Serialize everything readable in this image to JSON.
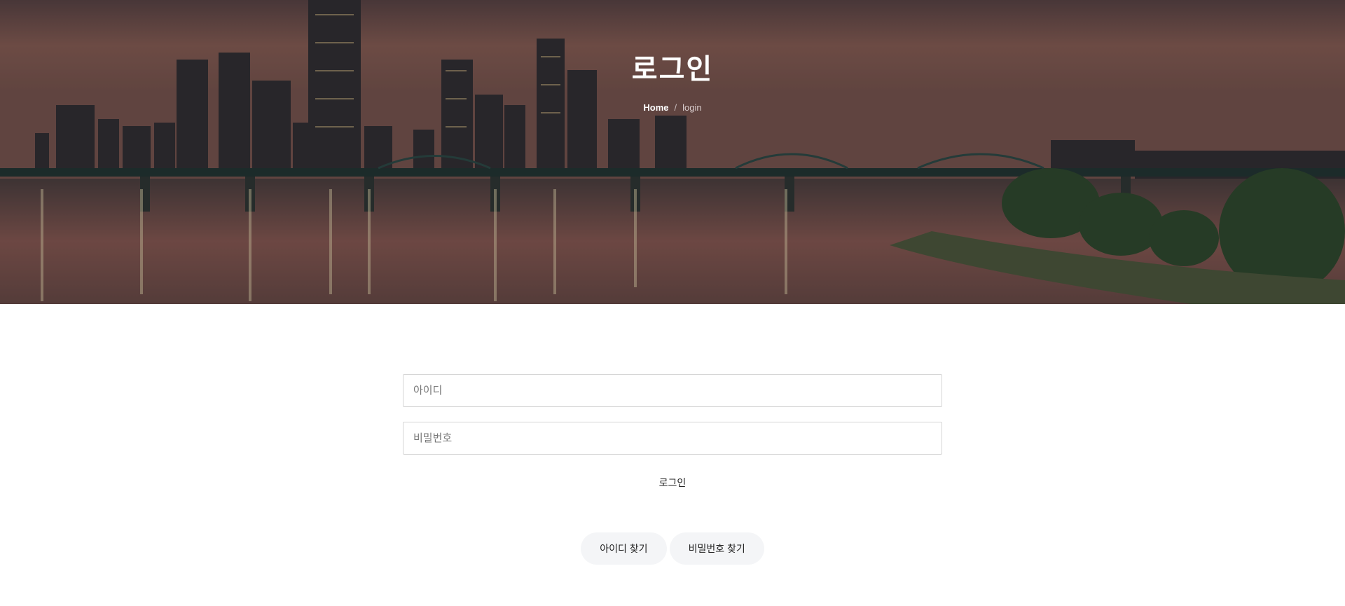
{
  "hero": {
    "title": "로그인",
    "breadcrumb": {
      "home": "Home",
      "separator": "/",
      "current": "login"
    }
  },
  "form": {
    "username_placeholder": "아이디",
    "password_placeholder": "비밀번호",
    "username_value": "",
    "password_value": "",
    "submit_label": "로그인"
  },
  "links": {
    "find_id_label": "아이디 찾기",
    "find_password_label": "비밀번호 찾기"
  },
  "colors": {
    "pill_background": "#f4f5f7",
    "field_border": "#d6d6d6"
  }
}
